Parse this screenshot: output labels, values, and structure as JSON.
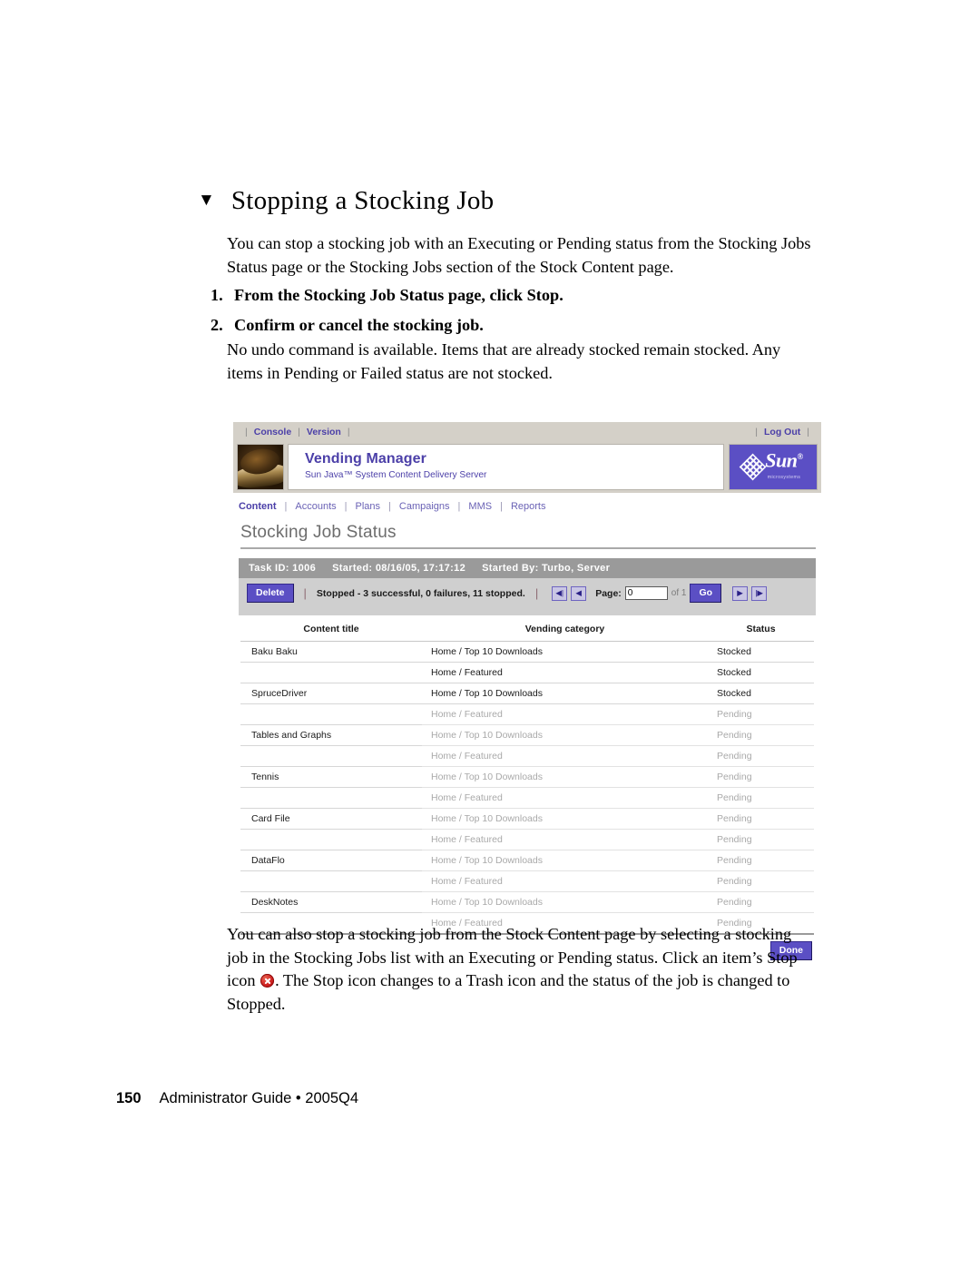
{
  "document": {
    "heading": "Stopping a Stocking Job",
    "heading_bullet": "triangle-down-bullet",
    "intro_paragraph": "You can stop a stocking job with an Executing or Pending status from the Stocking Jobs Status page or the Stocking Jobs section of the Stock Content page.",
    "steps": [
      {
        "number": "1.",
        "text": "From the Stocking Job Status page, click Stop."
      },
      {
        "number": "2.",
        "text": "Confirm or cancel the stocking job."
      }
    ],
    "undo_paragraph": "No undo command is available. Items that are already stocked remain stocked. Any items in Pending or Failed status are not stocked.",
    "closing_paragraph_part1": "You can also stop a stocking job from the Stock Content page by selecting a stocking job in the Stocking Jobs list with an Executing or Pending status. Click an item’s Stop icon",
    "closing_paragraph_part2": ". The Stop icon changes to a Trash icon and the status of the job is changed to Stopped.",
    "footer": {
      "page_number": "150",
      "text": "Administrator Guide • 2005Q4"
    }
  },
  "app": {
    "utility_bar": {
      "left_links": [
        "Console",
        "Version"
      ],
      "right_links": [
        "Log Out"
      ]
    },
    "banner": {
      "title": "Vending Manager",
      "subtitle": "Sun Java™ System Content Delivery Server",
      "logo_word": "Sun",
      "logo_tm": "®",
      "logo_micro": "microsystems"
    },
    "nav": {
      "items": [
        "Content",
        "Accounts",
        "Plans",
        "Campaigns",
        "MMS",
        "Reports"
      ],
      "active": "Content"
    },
    "page_title": "Stocking Job Status",
    "task": {
      "task_id_label": "Task ID: 1006",
      "started_label": "Started: 08/16/05, 17:17:12",
      "started_by_label": "Started By: Turbo, Server",
      "delete_button": "Delete",
      "status_text": "Stopped - 3 successful, 0 failures, 11 stopped.",
      "pager": {
        "first_icon": "◀|",
        "prev_icon": "◀",
        "label": "Page:",
        "value": "0",
        "placeholder": "0",
        "of_label": "of 1",
        "go_button": "Go",
        "next_icon": "▶",
        "last_icon": "|▶"
      }
    },
    "table": {
      "columns": [
        "Content title",
        "Vending category",
        "Status"
      ],
      "rows": [
        {
          "title": "Baku Baku",
          "category": "Home / Top 10 Downloads",
          "status": "Stocked",
          "dim": false
        },
        {
          "title": "",
          "category": "Home / Featured",
          "status": "Stocked",
          "dim": false
        },
        {
          "title": "SpruceDriver",
          "category": "Home / Top 10 Downloads",
          "status": "Stocked",
          "dim": false
        },
        {
          "title": "",
          "category": "Home / Featured",
          "status": "Pending",
          "dim": true
        },
        {
          "title": "Tables and Graphs",
          "category": "Home / Top 10 Downloads",
          "status": "Pending",
          "dim": true
        },
        {
          "title": "",
          "category": "Home / Featured",
          "status": "Pending",
          "dim": true
        },
        {
          "title": "Tennis",
          "category": "Home / Top 10 Downloads",
          "status": "Pending",
          "dim": true
        },
        {
          "title": "",
          "category": "Home / Featured",
          "status": "Pending",
          "dim": true
        },
        {
          "title": "Card File",
          "category": "Home / Top 10 Downloads",
          "status": "Pending",
          "dim": true
        },
        {
          "title": "",
          "category": "Home / Featured",
          "status": "Pending",
          "dim": true
        },
        {
          "title": "DataFlo",
          "category": "Home / Top 10 Downloads",
          "status": "Pending",
          "dim": true
        },
        {
          "title": "",
          "category": "Home / Featured",
          "status": "Pending",
          "dim": true
        },
        {
          "title": "DeskNotes",
          "category": "Home / Top 10 Downloads",
          "status": "Pending",
          "dim": true
        },
        {
          "title": "",
          "category": "Home / Featured",
          "status": "Pending",
          "dim": true
        }
      ]
    },
    "done_button": "Done"
  },
  "colors": {
    "accent_purple": "#5b4fc4",
    "link_purple": "#4b3fa8",
    "chrome_gray": "#d4d0c8",
    "task_header_gray": "#9a9a9a",
    "toolbar_gray": "#cfcfcf",
    "dim_text": "#a9a9a9",
    "stop_icon_red": "#cf2020"
  }
}
